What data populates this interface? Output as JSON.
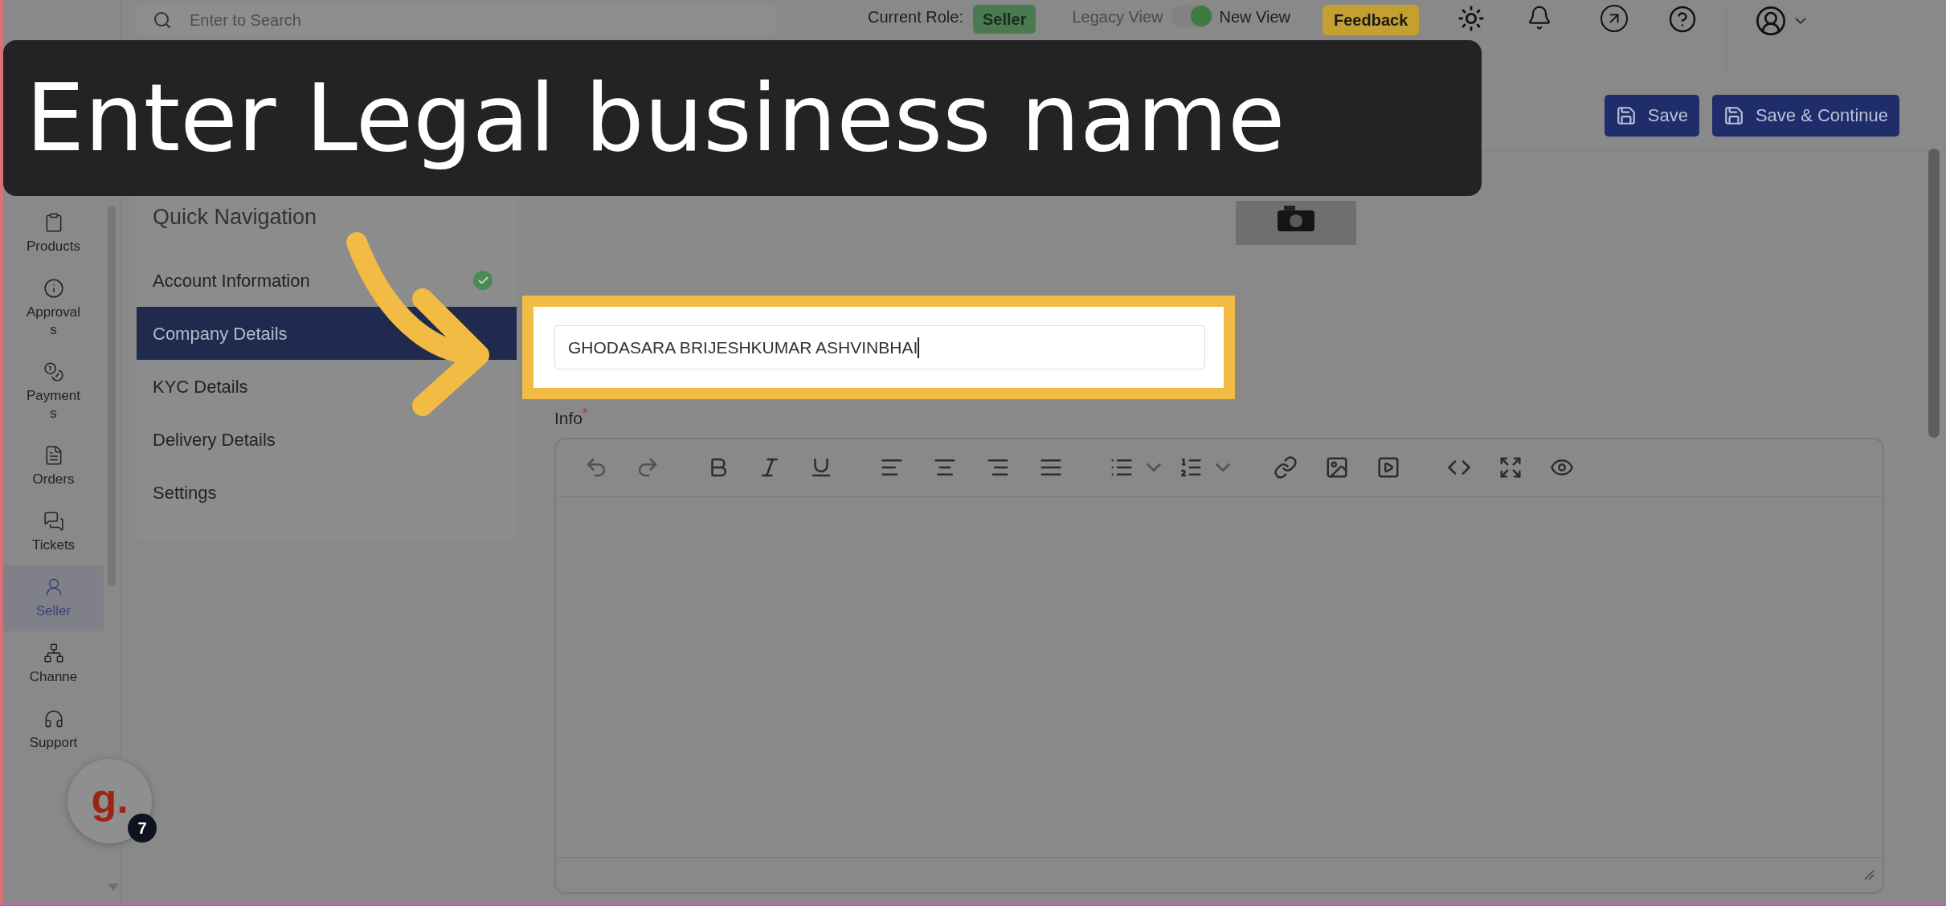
{
  "caption": {
    "text": "Enter Legal business name"
  },
  "topbar": {
    "search": {
      "placeholder": "Enter to Search"
    },
    "role_label": "Current Role:",
    "role_badge": "Seller",
    "legacy_view": "Legacy View",
    "view_toggle": {
      "on": true
    },
    "new_view": "New View",
    "feedback": "Feedback"
  },
  "sidebar": {
    "items": [
      {
        "label": "Products",
        "selected": false
      },
      {
        "label": "Approvals",
        "selected": false
      },
      {
        "label": "Payments",
        "selected": false
      },
      {
        "label": "Orders",
        "selected": false
      },
      {
        "label": "Tickets",
        "selected": false
      },
      {
        "label": "Seller",
        "selected": true
      },
      {
        "label": "Channe",
        "selected": false
      },
      {
        "label": "Support",
        "selected": false
      }
    ]
  },
  "header": {
    "buttons": [
      "Save",
      "Save & Continue"
    ]
  },
  "quick_navigation": {
    "title": "Quick Navigation",
    "items": [
      {
        "label": "Account Information",
        "selected": false,
        "completed": true
      },
      {
        "label": "Company Details",
        "selected": true,
        "completed": false
      },
      {
        "label": "KYC Details",
        "selected": false,
        "completed": false
      },
      {
        "label": "Delivery Details",
        "selected": false,
        "completed": false
      },
      {
        "label": "Settings",
        "selected": false,
        "completed": false
      }
    ]
  },
  "form": {
    "legal_name": {
      "value": "GHODASARA BRIJESHKUMAR ASHVINBHAI"
    },
    "info": {
      "label": "Info",
      "required_mark": "*"
    }
  },
  "launcher": {
    "logo": "g.",
    "count": "7"
  }
}
